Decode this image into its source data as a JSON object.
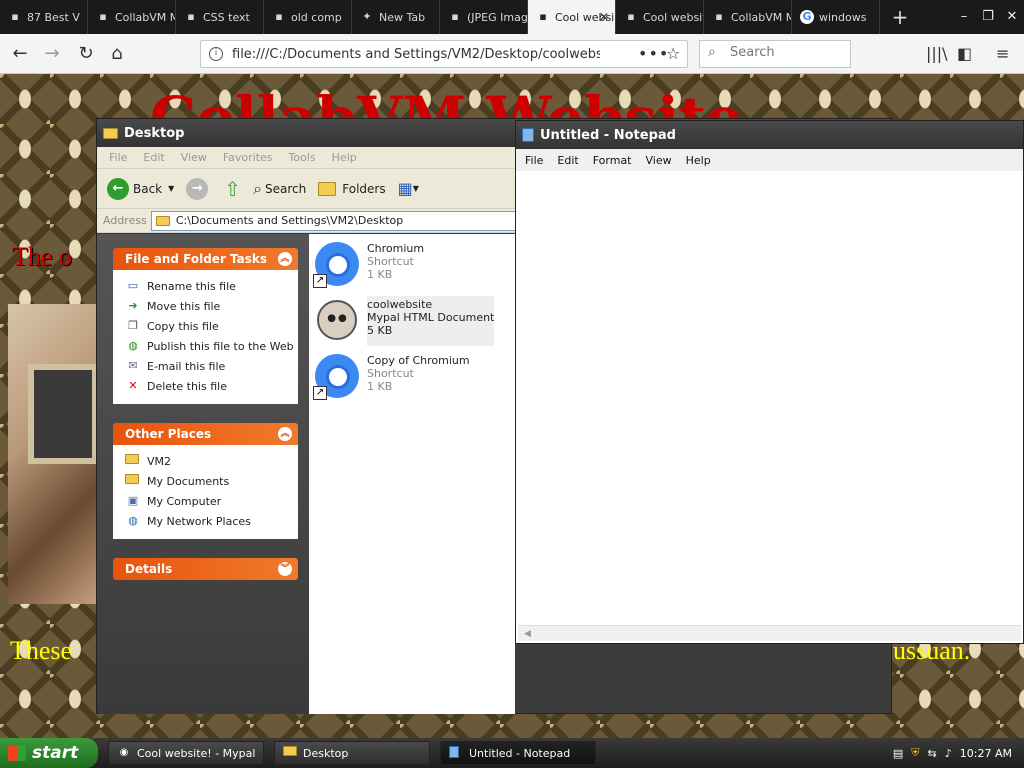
{
  "browser": {
    "tabs": [
      {
        "label": "87 Best V",
        "icon": "tab-favicon"
      },
      {
        "label": "CollabVM Mus",
        "icon": "tab-favicon"
      },
      {
        "label": "CSS text",
        "icon": "tab-favicon"
      },
      {
        "label": "old comp",
        "icon": "tab-favicon"
      },
      {
        "label": "New Tab",
        "icon": "tab-favicon"
      },
      {
        "label": "(JPEG Image,",
        "icon": "tab-favicon"
      },
      {
        "label": "Cool websi",
        "icon": "tab-favicon",
        "active": true
      },
      {
        "label": "Cool website!",
        "icon": "tab-favicon"
      },
      {
        "label": "CollabVM Mus",
        "icon": "tab-favicon"
      },
      {
        "label": "windows",
        "icon": "google-icon"
      }
    ],
    "url": "file:///C:/Documents and Settings/VM2/Desktop/coolwebsite.htm",
    "search_placeholder": "Search"
  },
  "website": {
    "heading": "CollabVM Website",
    "sub": "The o",
    "footer_left": "These",
    "footer_right": "ussuan."
  },
  "explorer": {
    "title": "Desktop",
    "menu": [
      "File",
      "Edit",
      "View",
      "Favorites",
      "Tools",
      "Help"
    ],
    "toolbar": {
      "back": "Back",
      "search": "Search",
      "folders": "Folders"
    },
    "address_label": "Address",
    "address": "C:\\Documents and Settings\\VM2\\Desktop",
    "file_tasks": {
      "title": "File and Folder Tasks",
      "items": [
        "Rename this file",
        "Move this file",
        "Copy this file",
        "Publish this file to the Web",
        "E-mail this file",
        "Delete this file"
      ]
    },
    "other_places": {
      "title": "Other Places",
      "items": [
        "VM2",
        "My Documents",
        "My Computer",
        "My Network Places"
      ]
    },
    "details": {
      "title": "Details"
    },
    "files": [
      {
        "name": "Chromium",
        "type": "Shortcut",
        "size": "1 KB"
      },
      {
        "name": "coolwebsite",
        "type": "Mypal HTML Document",
        "size": "5 KB"
      },
      {
        "name": "Copy of Chromium",
        "type": "Shortcut",
        "size": "1 KB"
      }
    ]
  },
  "notepad": {
    "title": "Untitled - Notepad",
    "menu": [
      "File",
      "Edit",
      "Format",
      "View",
      "Help"
    ],
    "content": ""
  },
  "taskbar": {
    "start": "start",
    "tasks": [
      {
        "label": "Cool website! - Mypal"
      },
      {
        "label": "Desktop"
      },
      {
        "label": "Untitled - Notepad",
        "active": true
      }
    ],
    "clock": "10:27 AM"
  }
}
